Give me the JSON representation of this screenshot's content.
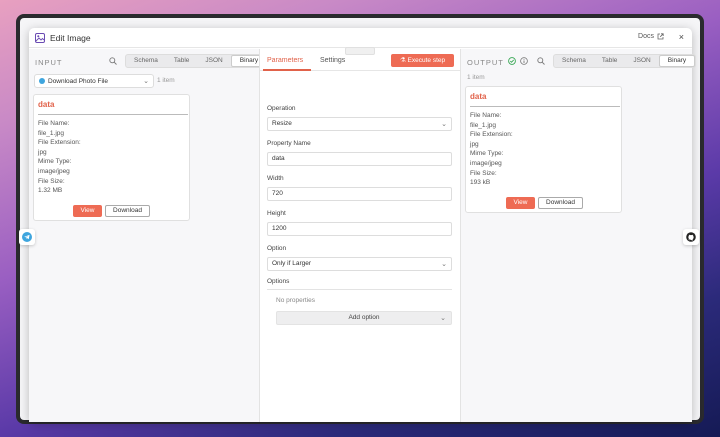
{
  "modal": {
    "title": "Edit Image",
    "docs_label": "Docs",
    "close_glyph": "×"
  },
  "input": {
    "label": "INPUT",
    "tabs": [
      "Schema",
      "Table",
      "JSON",
      "Binary"
    ],
    "active_tab": "Binary",
    "node_select": "Download Photo File",
    "count": "1 item",
    "card": {
      "title": "data",
      "lines": [
        "File Name:",
        "file_1.jpg",
        "File Extension:",
        "jpg",
        "Mime Type:",
        "image/jpeg",
        "File Size:",
        "1.32 MB"
      ],
      "view_label": "View",
      "download_label": "Download"
    }
  },
  "params": {
    "tabs": [
      "Parameters",
      "Settings"
    ],
    "active_tab": "Parameters",
    "execute_label": "Execute step",
    "fields": {
      "operation": {
        "label": "Operation",
        "value": "Resize"
      },
      "property_name": {
        "label": "Property Name",
        "value": "data"
      },
      "width": {
        "label": "Width",
        "value": "720"
      },
      "height": {
        "label": "Height",
        "value": "1200"
      },
      "option": {
        "label": "Option",
        "value": "Only if Larger"
      }
    },
    "options_label": "Options",
    "no_properties": "No properties",
    "add_option_label": "Add option"
  },
  "output": {
    "label": "OUTPUT",
    "tabs": [
      "Schema",
      "Table",
      "JSON",
      "Binary"
    ],
    "active_tab": "Binary",
    "count": "1 item",
    "card": {
      "title": "data",
      "lines": [
        "File Name:",
        "file_1.jpg",
        "File Extension:",
        "jpg",
        "Mime Type:",
        "image/jpeg",
        "File Size:",
        "193 kB"
      ],
      "view_label": "View",
      "download_label": "Download"
    }
  },
  "colors": {
    "accent": "#ee6b54",
    "success": "#3aa856",
    "telegram": "#3ea5de"
  },
  "icons": [
    "image-icon",
    "external-link-icon",
    "close-icon",
    "search-icon",
    "chevron-down-icon",
    "flask-icon",
    "check-circle-icon",
    "info-icon",
    "telegram-icon",
    "github-icon"
  ]
}
